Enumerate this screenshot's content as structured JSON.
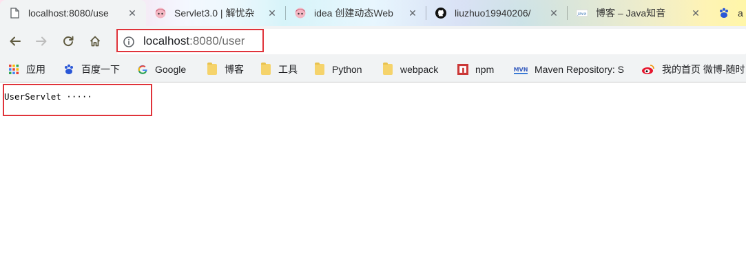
{
  "tabs": [
    {
      "title": "localhost:8080/use",
      "favicon": "page-icon",
      "active": true
    },
    {
      "title": "Servlet3.0 | 解忧杂",
      "favicon": "anime-avatar-icon"
    },
    {
      "title": "idea 创建动态Web",
      "favicon": "anime-avatar-icon"
    },
    {
      "title": "liuzhuo19940206/",
      "favicon": "github-icon"
    },
    {
      "title": "博客 – Java知音",
      "favicon": "java-icon"
    },
    {
      "title": "a",
      "favicon": "baidu-paw-icon"
    }
  ],
  "tab_close_glyph": "✕",
  "toolbar": {
    "back": "back-arrow-icon",
    "forward": "forward-arrow-icon",
    "reload": "reload-icon",
    "home": "home-icon"
  },
  "address": {
    "host": "localhost",
    "rest": ":8080/user",
    "info_icon": "info-icon"
  },
  "bookmarks": [
    {
      "label": "应用",
      "icon": "apps-grid-icon"
    },
    {
      "label": "百度一下",
      "icon": "baidu-paw-icon"
    },
    {
      "label": "Google",
      "icon": "google-icon"
    },
    {
      "label": "博客",
      "icon": "folder-icon"
    },
    {
      "label": "工具",
      "icon": "folder-icon"
    },
    {
      "label": "Python",
      "icon": "folder-icon"
    },
    {
      "label": "webpack",
      "icon": "folder-icon"
    },
    {
      "label": "npm",
      "icon": "npm-icon"
    },
    {
      "label": "Maven Repository: S",
      "icon": "mvn-icon"
    },
    {
      "label": "我的首页 微博-随时",
      "icon": "weibo-icon"
    }
  ],
  "page": {
    "body_text": "UserServlet ·····"
  },
  "colors": {
    "highlight_border": "#e0333a",
    "toolbar_bg": "#f1f3f4"
  }
}
